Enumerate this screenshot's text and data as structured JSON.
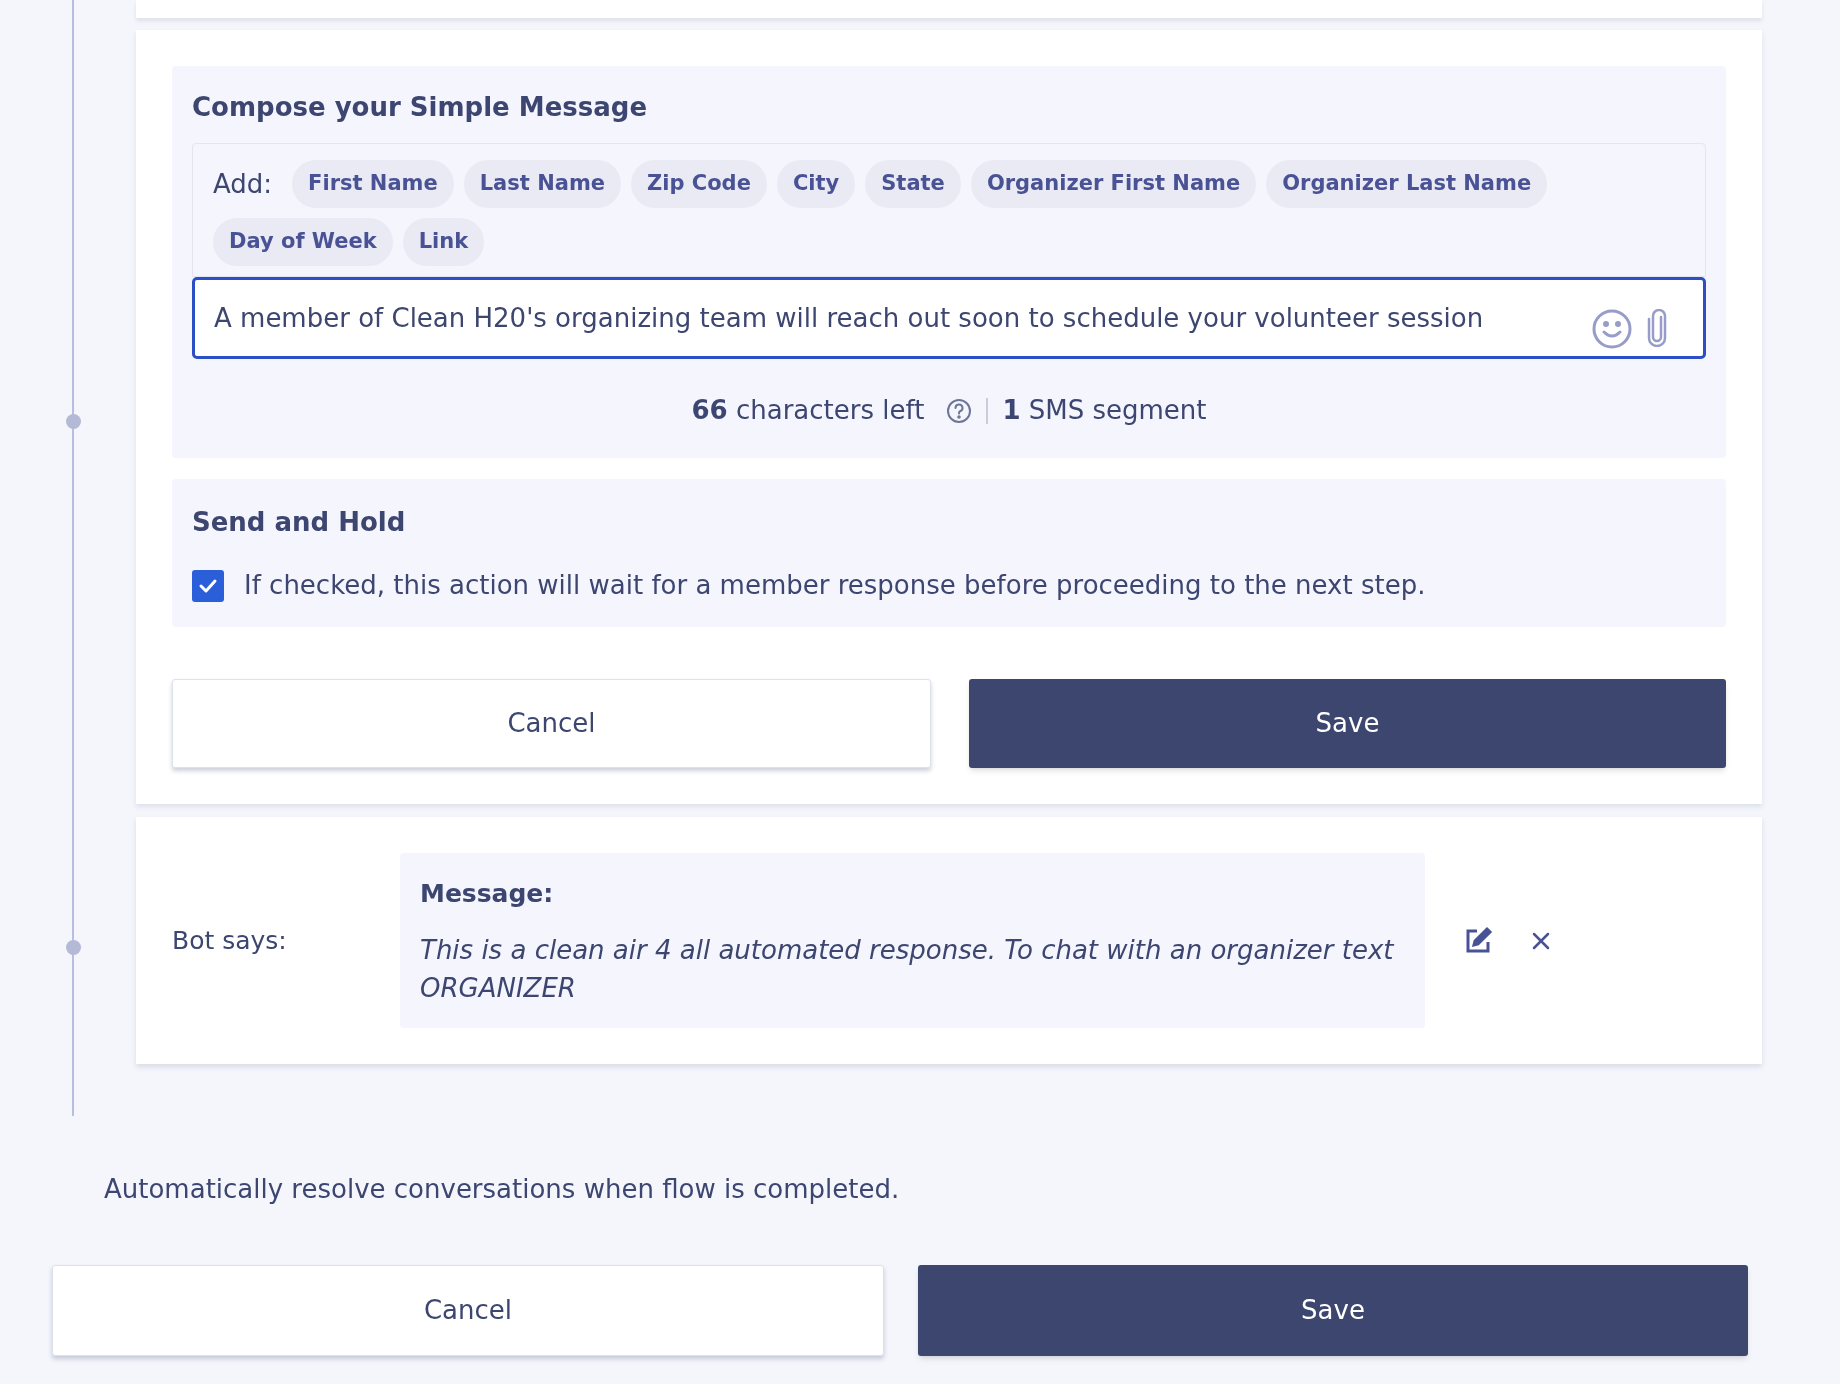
{
  "compose": {
    "title": "Compose your Simple Message",
    "add_label": "Add:",
    "tokens": [
      "First Name",
      "Last Name",
      "Zip Code",
      "City",
      "State",
      "Organizer First Name",
      "Organizer Last Name",
      "Day of Week",
      "Link"
    ],
    "message_value": "A member of Clean H20's organizing team will reach out soon to schedule your volunteer session",
    "characters_left_count": "66",
    "characters_left_label": "characters left",
    "segment_count": "1",
    "segment_label": "SMS segment"
  },
  "send_and_hold": {
    "title": "Send and Hold",
    "checked": true,
    "description": "If checked, this action will wait for a member response before proceeding to the next step."
  },
  "step_buttons": [
    {
      "label": "Cancel",
      "kind": "secondary"
    },
    {
      "label": "Save",
      "kind": "primary"
    }
  ],
  "bot_step": {
    "label": "Bot says:",
    "message_title": "Message:",
    "message_text": "This is a clean air 4 all automated response. To chat with an organizer text ORGANIZER"
  },
  "auto_resolve": {
    "text": "Automatically resolve conversations when flow is completed."
  },
  "flow_buttons": [
    {
      "label": "Cancel",
      "kind": "secondary"
    },
    {
      "label": "Save",
      "kind": "primary"
    }
  ]
}
